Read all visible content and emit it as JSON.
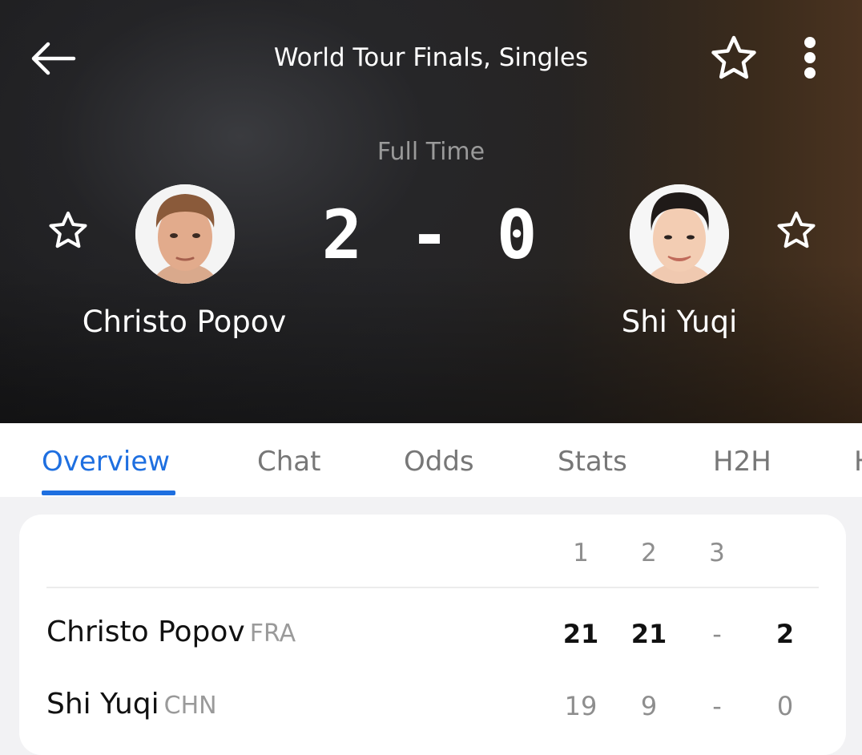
{
  "header": {
    "title": "World Tour Finals, Singles",
    "status": "Full Time",
    "score": "2 - 0"
  },
  "players": {
    "home": {
      "name": "Christo Popov",
      "country": "FRA"
    },
    "away": {
      "name": "Shi Yuqi",
      "country": "CHN"
    }
  },
  "tabs": [
    "Overview",
    "Chat",
    "Odds",
    "Stats",
    "H2H",
    "H"
  ],
  "active_tab": "Overview",
  "scoreboard": {
    "set_headers": [
      "1",
      "2",
      "3"
    ],
    "rows": [
      {
        "name": "Christo Popov",
        "country": "FRA",
        "sets": [
          "21",
          "21",
          "-"
        ],
        "total": "2"
      },
      {
        "name": "Shi Yuqi",
        "country": "CHN",
        "sets": [
          "19",
          "9",
          "-"
        ],
        "total": "0"
      }
    ]
  },
  "colors": {
    "accent": "#1e6fe0",
    "muted": "#8e8e8e"
  }
}
